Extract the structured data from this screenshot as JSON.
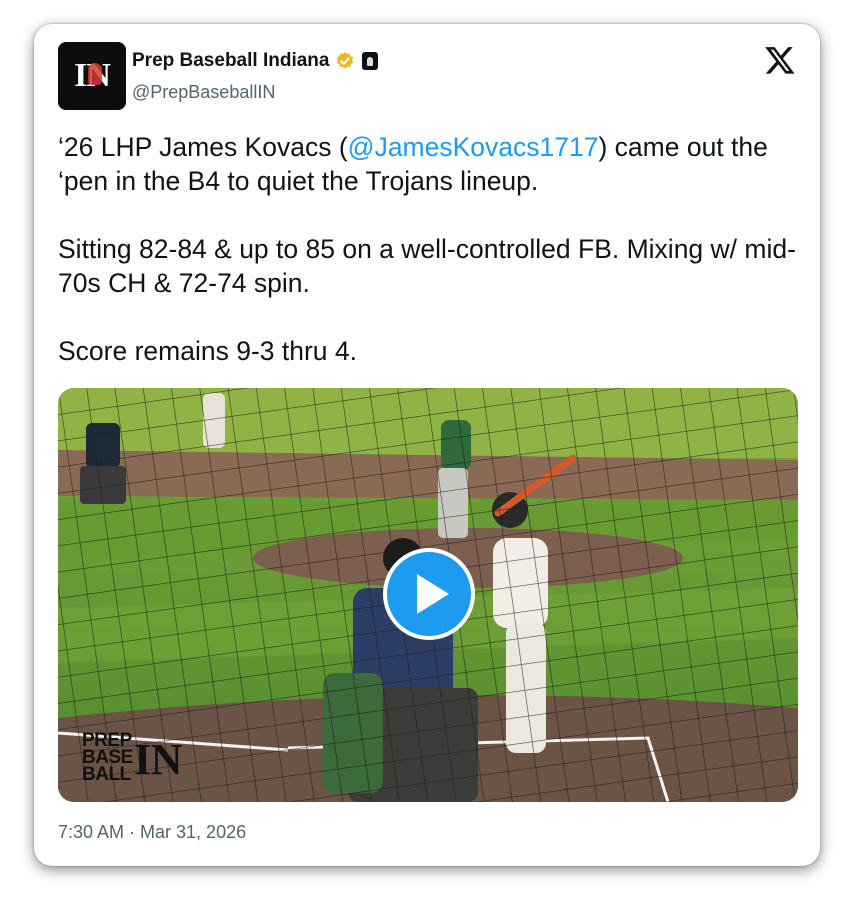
{
  "tweet": {
    "author_name": "Prep Baseball Indiana",
    "handle": "@PrepBaseballIN",
    "avatar_text": "IN",
    "text_line1_pre": "‘26 LHP James Kovacs (",
    "mention": "@JamesKovacs1717",
    "text_line1_post": ") came out the ‘pen in the B4 to quiet the Trojans lineup.",
    "paragraph2": "Sitting 82-84 & up to 85 on a well-controlled FB. Mixing w/ mid-70s CH & 72-74 spin.",
    "paragraph3": "Score remains 9-3 thru 4.",
    "timestamp": "7:30 AM · Mar 31, 2026"
  },
  "media": {
    "type": "video",
    "watermark_line1": "PREP",
    "watermark_line2": "BASE",
    "watermark_line3": "BALL",
    "watermark_logo": "IN"
  },
  "icons": {
    "verified": "verified-badge-icon",
    "affiliate": "affiliate-badge-icon",
    "platform": "x-logo-icon",
    "play": "play-icon"
  },
  "colors": {
    "accent": "#1d9bf0",
    "verified": "#e8b923",
    "text": "#0f1419",
    "muted": "#536471"
  }
}
